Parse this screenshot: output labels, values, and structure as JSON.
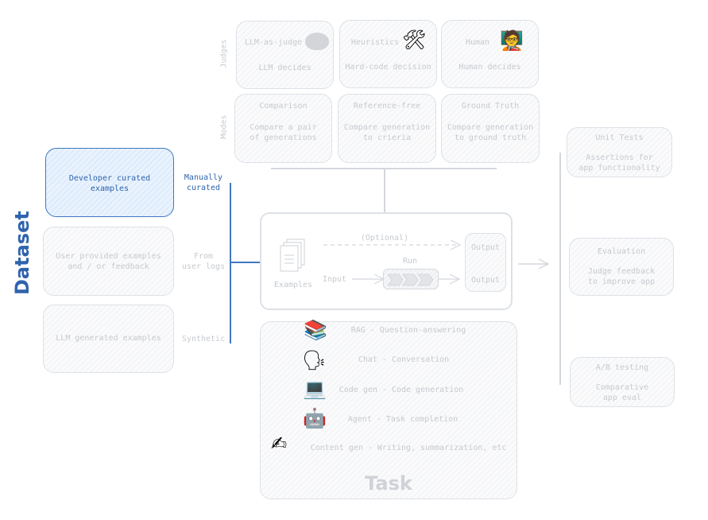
{
  "dataset": {
    "title": "Dataset",
    "sources": [
      {
        "box_text": "Developer curated\nexamples",
        "label": "Manually\ncurated",
        "highlighted": true
      },
      {
        "box_text": "User provided examples\nand / or feedback",
        "label": "From\nuser logs",
        "highlighted": false
      },
      {
        "box_text": "LLM generated examples",
        "label": "Synthetic",
        "highlighted": false
      }
    ]
  },
  "judges": {
    "row_label": "Judges",
    "items": [
      {
        "title": "LLM-as-judge",
        "desc": "LLM decides",
        "icon": "brain-icon"
      },
      {
        "title": "Heuristics",
        "desc": "Hard-code decision",
        "icon": "hammer-wrench-icon"
      },
      {
        "title": "Human",
        "desc": "Human decides",
        "icon": "teacher-icon"
      }
    ]
  },
  "modes": {
    "row_label": "Modes",
    "items": [
      {
        "title": "Comparison",
        "desc": "Compare a pair\nof generations"
      },
      {
        "title": "Reference-free",
        "desc": "Compare generation\nto crieria"
      },
      {
        "title": "Ground Truth",
        "desc": "Compare generation\nto ground truth"
      }
    ]
  },
  "pipeline": {
    "examples_label": "Examples",
    "optional_label": "(Optional)",
    "run_label": "Run",
    "input_label": "Input",
    "output_top": "Output",
    "output_bottom": "Output"
  },
  "task": {
    "title": "Task",
    "items": [
      {
        "label": "RAG - Question-answering",
        "icon": "books-icon",
        "glyph": "📚"
      },
      {
        "label": "Chat - Conversation",
        "icon": "speaking-head-icon",
        "glyph": "🗣"
      },
      {
        "label": "Code gen - Code generation",
        "icon": "laptop-icon",
        "glyph": "💻"
      },
      {
        "label": "Agent - Task completion",
        "icon": "robot-icon",
        "glyph": "🤖"
      },
      {
        "label": "Content gen - Writing, summarization, etc",
        "icon": "writing-hand-icon",
        "glyph": "✍"
      }
    ]
  },
  "applications": [
    {
      "title": "Unit Tests",
      "desc": "Assertions for\napp functionality"
    },
    {
      "title": "Evaluation",
      "desc": "Judge feedback\nto improve app"
    },
    {
      "title": "A/B testing",
      "desc": "Comparative\napp eval"
    }
  ]
}
